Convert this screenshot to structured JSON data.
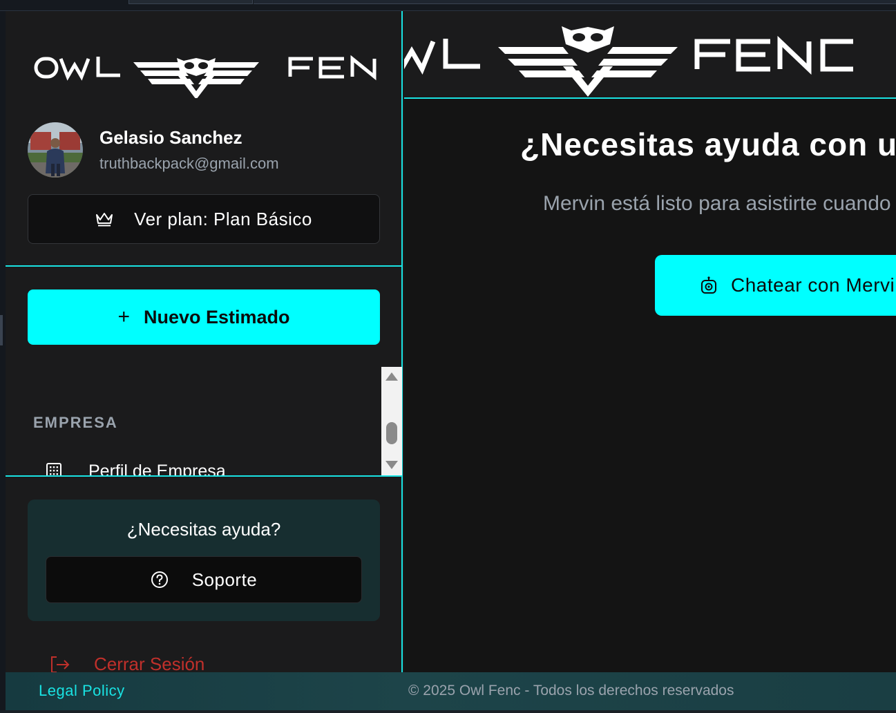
{
  "brand": {
    "logo_left_word": "OWL",
    "logo_right_word": "FENC"
  },
  "user": {
    "name": "Gelasio Sanchez",
    "email": "truthbackpack@gmail.com"
  },
  "sidebar": {
    "plan_button_label": "Ver plan: Plan Básico",
    "plan_icon": "crown-icon",
    "new_estimate_label": "Nuevo Estimado",
    "new_estimate_icon": "plus-icon",
    "section_empresa": "EMPRESA",
    "nav_items": [
      {
        "label": "Perfil de Empresa",
        "icon": "building-icon"
      }
    ],
    "help_title": "¿Necesitas ayuda?",
    "support_label": "Soporte",
    "support_icon": "help-circle-icon",
    "logout_label": "Cerrar Sesión",
    "logout_icon": "logout-icon"
  },
  "main": {
    "title": "¿Necesitas ayuda con un",
    "subtitle": "Mervin está listo para asistirte cuando",
    "chat_button_label": "Chatear con Mervin",
    "chat_icon": "bot-icon"
  },
  "footer": {
    "legal_label": "Legal Policy",
    "copyright": "© 2025 Owl Fenc - Todos los derechos reservados"
  },
  "colors": {
    "accent": "#00ffff",
    "danger": "#c0302b",
    "sidebar_bg": "#1b1b1c",
    "main_bg": "#141414"
  }
}
